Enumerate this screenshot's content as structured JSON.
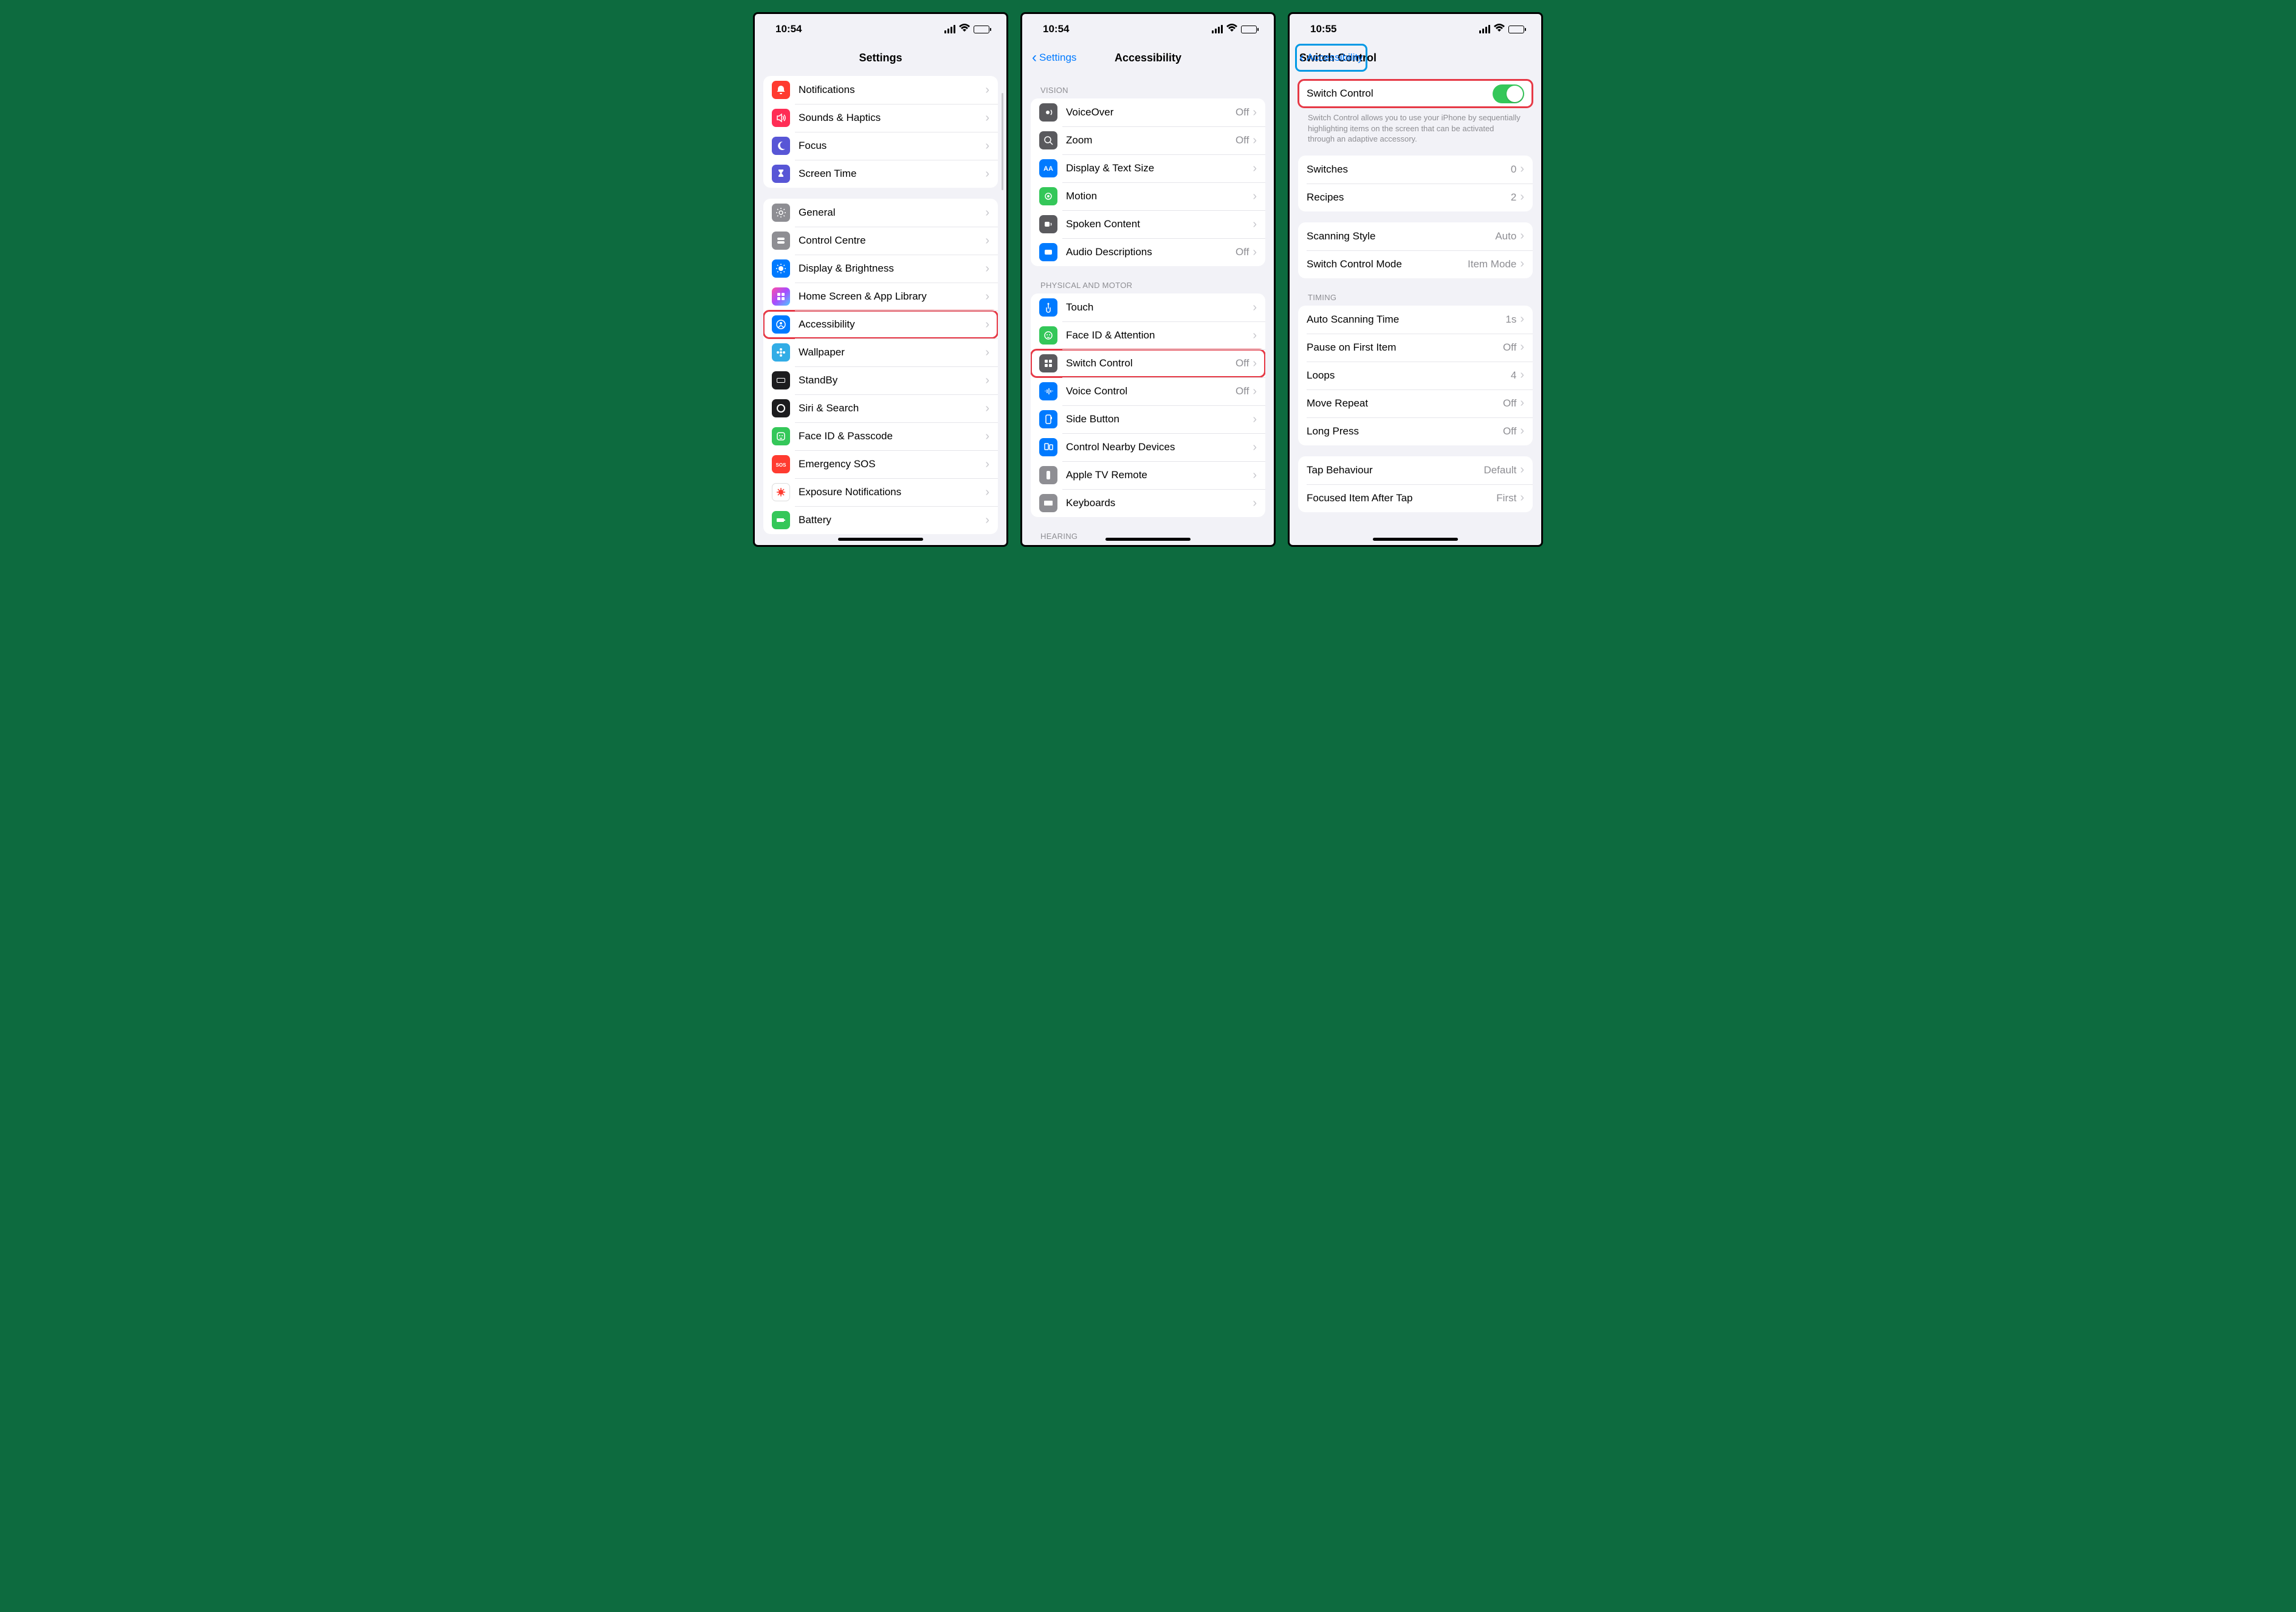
{
  "screen1": {
    "time": "10:54",
    "title": "Settings",
    "groups": [
      {
        "rows": [
          {
            "id": "notifications",
            "label": "Notifications",
            "icon": "bell",
            "color": "bg-red"
          },
          {
            "id": "sounds",
            "label": "Sounds & Haptics",
            "icon": "speaker",
            "color": "bg-pink"
          },
          {
            "id": "focus",
            "label": "Focus",
            "icon": "moon",
            "color": "bg-indigo"
          },
          {
            "id": "screentime",
            "label": "Screen Time",
            "icon": "hourglass",
            "color": "bg-indigo"
          }
        ]
      },
      {
        "rows": [
          {
            "id": "general",
            "label": "General",
            "icon": "gear",
            "color": "bg-gray"
          },
          {
            "id": "controlcentre",
            "label": "Control Centre",
            "icon": "toggles",
            "color": "bg-gray"
          },
          {
            "id": "display",
            "label": "Display & Brightness",
            "icon": "sun",
            "color": "bg-blue"
          },
          {
            "id": "homescreen",
            "label": "Home Screen & App Library",
            "icon": "grid",
            "color": "bg-grad"
          },
          {
            "id": "accessibility",
            "label": "Accessibility",
            "icon": "person",
            "color": "bg-blue",
            "highlight": true
          },
          {
            "id": "wallpaper",
            "label": "Wallpaper",
            "icon": "flower",
            "color": "bg-cyan"
          },
          {
            "id": "standby",
            "label": "StandBy",
            "icon": "clock",
            "color": "bg-black"
          },
          {
            "id": "siri",
            "label": "Siri & Search",
            "icon": "siri",
            "color": "bg-black"
          },
          {
            "id": "faceid",
            "label": "Face ID & Passcode",
            "icon": "face",
            "color": "bg-green"
          },
          {
            "id": "sos",
            "label": "Emergency SOS",
            "icon": "sos",
            "color": "bg-red"
          },
          {
            "id": "exposure",
            "label": "Exposure Notifications",
            "icon": "virus",
            "color": "bg-white"
          },
          {
            "id": "battery",
            "label": "Battery",
            "icon": "battery",
            "color": "bg-green"
          }
        ]
      }
    ]
  },
  "screen2": {
    "time": "10:54",
    "back": "Settings",
    "title": "Accessibility",
    "sections": [
      {
        "header": "Vision",
        "rows": [
          {
            "id": "voiceover",
            "label": "VoiceOver",
            "value": "Off",
            "icon": "voiceover",
            "color": "bg-darkgray"
          },
          {
            "id": "zoom",
            "label": "Zoom",
            "value": "Off",
            "icon": "zoom",
            "color": "bg-darkgray"
          },
          {
            "id": "textsize",
            "label": "Display & Text Size",
            "icon": "aa",
            "color": "bg-blue"
          },
          {
            "id": "motion",
            "label": "Motion",
            "icon": "motion",
            "color": "bg-green"
          },
          {
            "id": "spoken",
            "label": "Spoken Content",
            "icon": "spoken",
            "color": "bg-darkgray"
          },
          {
            "id": "audiodesc",
            "label": "Audio Descriptions",
            "value": "Off",
            "icon": "ad",
            "color": "bg-blue"
          }
        ]
      },
      {
        "header": "Physical and Motor",
        "rows": [
          {
            "id": "touch",
            "label": "Touch",
            "icon": "touch",
            "color": "bg-blue"
          },
          {
            "id": "faceatt",
            "label": "Face ID & Attention",
            "icon": "face2",
            "color": "bg-green"
          },
          {
            "id": "switchcontrol",
            "label": "Switch Control",
            "value": "Off",
            "icon": "switch",
            "color": "bg-darkgray",
            "highlight": true
          },
          {
            "id": "voicecontrol",
            "label": "Voice Control",
            "value": "Off",
            "icon": "voice",
            "color": "bg-blue"
          },
          {
            "id": "sidebutton",
            "label": "Side Button",
            "icon": "side",
            "color": "bg-blue"
          },
          {
            "id": "nearby",
            "label": "Control Nearby Devices",
            "icon": "nearby",
            "color": "bg-blue"
          },
          {
            "id": "appletv",
            "label": "Apple TV Remote",
            "icon": "remote",
            "color": "bg-gray"
          },
          {
            "id": "keyboards",
            "label": "Keyboards",
            "icon": "keyboard",
            "color": "bg-gray"
          }
        ]
      },
      {
        "header": "Hearing",
        "rows": []
      }
    ]
  },
  "screen3": {
    "time": "10:55",
    "back": "Accessibility",
    "title": "Switch Control",
    "toggle": {
      "label": "Switch Control",
      "on": true
    },
    "footnote": "Switch Control allows you to use your iPhone by sequentially highlighting items on the screen that can be activated through an adaptive accessory.",
    "groups": [
      {
        "rows": [
          {
            "id": "switches",
            "label": "Switches",
            "value": "0"
          },
          {
            "id": "recipes",
            "label": "Recipes",
            "value": "2"
          }
        ]
      },
      {
        "rows": [
          {
            "id": "scanstyle",
            "label": "Scanning Style",
            "value": "Auto"
          },
          {
            "id": "mode",
            "label": "Switch Control Mode",
            "value": "Item Mode"
          }
        ]
      },
      {
        "header": "Timing",
        "rows": [
          {
            "id": "autoscan",
            "label": "Auto Scanning Time",
            "value": "1s"
          },
          {
            "id": "pause",
            "label": "Pause on First Item",
            "value": "Off"
          },
          {
            "id": "loops",
            "label": "Loops",
            "value": "4"
          },
          {
            "id": "moverepeat",
            "label": "Move Repeat",
            "value": "Off"
          },
          {
            "id": "longpress",
            "label": "Long Press",
            "value": "Off"
          }
        ]
      },
      {
        "rows": [
          {
            "id": "tapbehav",
            "label": "Tap Behaviour",
            "value": "Default"
          },
          {
            "id": "focused",
            "label": "Focused Item After Tap",
            "value": "First"
          }
        ]
      }
    ]
  }
}
